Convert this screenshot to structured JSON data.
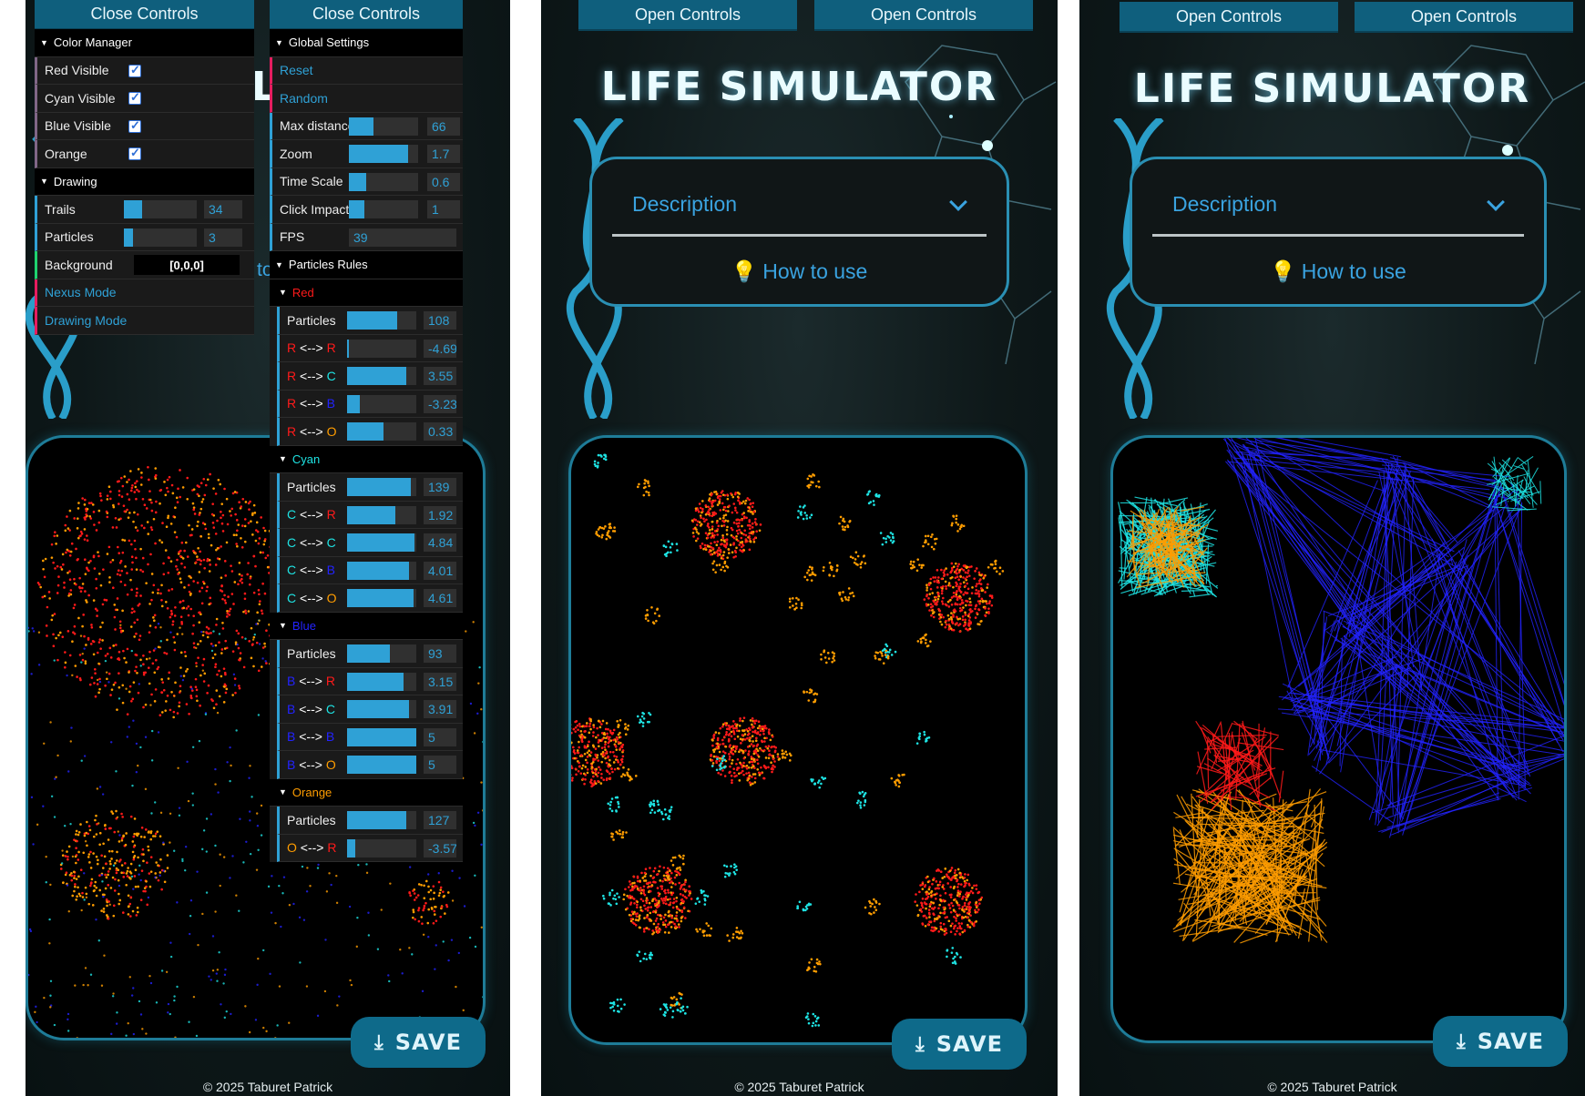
{
  "panels": {
    "p1": {
      "controls_left": "Close Controls",
      "controls_right": "Close Controls",
      "partial_title": "L",
      "partial_howto": "to",
      "save_label": "SAVE",
      "footer": "© 2025 Taburet Patrick",
      "color_manager": {
        "title": "Color Manager",
        "items": [
          {
            "label": "Red Visible",
            "checked": true
          },
          {
            "label": "Cyan Visible",
            "checked": true
          },
          {
            "label": "Blue Visible",
            "checked": true
          },
          {
            "label": "Orange",
            "checked": true
          }
        ]
      },
      "drawing": {
        "title": "Drawing",
        "trails_label": "Trails",
        "trails_value": "34",
        "trails_fill": 0.25,
        "particles_label": "Particles",
        "particles_value": "3",
        "particles_fill": 0.12,
        "background_label": "Background",
        "background_value": "[0,0,0]",
        "nexus_label": "Nexus Mode",
        "drawing_mode_label": "Drawing Mode"
      },
      "global": {
        "title": "Global Settings",
        "reset": "Reset",
        "random": "Random",
        "sliders": [
          {
            "label": "Max distance",
            "value": "66",
            "fill": 0.35
          },
          {
            "label": "Zoom",
            "value": "1.7",
            "fill": 0.85
          },
          {
            "label": "Time Scale",
            "value": "0.6",
            "fill": 0.25
          },
          {
            "label": "Click Impact",
            "value": "1",
            "fill": 0.22
          }
        ],
        "fps_label": "FPS",
        "fps_value": "39"
      },
      "rules": {
        "title": "Particles Rules",
        "groups": [
          {
            "name": "Red",
            "color": "#ff1a1a",
            "rows": [
              {
                "label": "Particles",
                "value": "108",
                "fill": 0.72
              },
              {
                "a": "R",
                "b": "R",
                "ac": "#ff1a1a",
                "bc": "#ff1a1a",
                "value": "-4.69",
                "fill": 0.03
              },
              {
                "a": "R",
                "b": "C",
                "ac": "#ff1a1a",
                "bc": "#1ee3e3",
                "value": "3.55",
                "fill": 0.86
              },
              {
                "a": "R",
                "b": "B",
                "ac": "#ff1a1a",
                "bc": "#2323ff",
                "value": "-3.23",
                "fill": 0.18
              },
              {
                "a": "R",
                "b": "O",
                "ac": "#ff1a1a",
                "bc": "#ff9d00",
                "value": "0.33",
                "fill": 0.53
              }
            ]
          },
          {
            "name": "Cyan",
            "color": "#1ee3e3",
            "rows": [
              {
                "label": "Particles",
                "value": "139",
                "fill": 0.92
              },
              {
                "a": "C",
                "b": "R",
                "ac": "#1ee3e3",
                "bc": "#ff1a1a",
                "value": "1.92",
                "fill": 0.7
              },
              {
                "a": "C",
                "b": "C",
                "ac": "#1ee3e3",
                "bc": "#1ee3e3",
                "value": "4.84",
                "fill": 0.98
              },
              {
                "a": "C",
                "b": "B",
                "ac": "#1ee3e3",
                "bc": "#2323ff",
                "value": "4.01",
                "fill": 0.9
              },
              {
                "a": "C",
                "b": "O",
                "ac": "#1ee3e3",
                "bc": "#ff9d00",
                "value": "4.61",
                "fill": 0.96
              }
            ]
          },
          {
            "name": "Blue",
            "color": "#2323ff",
            "rows": [
              {
                "label": "Particles",
                "value": "93",
                "fill": 0.62
              },
              {
                "a": "B",
                "b": "R",
                "ac": "#2323ff",
                "bc": "#ff1a1a",
                "value": "3.15",
                "fill": 0.82
              },
              {
                "a": "B",
                "b": "C",
                "ac": "#2323ff",
                "bc": "#1ee3e3",
                "value": "3.91",
                "fill": 0.89
              },
              {
                "a": "B",
                "b": "B",
                "ac": "#2323ff",
                "bc": "#2323ff",
                "value": "5",
                "fill": 1.0
              },
              {
                "a": "B",
                "b": "O",
                "ac": "#2323ff",
                "bc": "#ff9d00",
                "value": "5",
                "fill": 1.0
              }
            ]
          },
          {
            "name": "Orange",
            "color": "#ff9d00",
            "rows": [
              {
                "label": "Particles",
                "value": "127",
                "fill": 0.85
              },
              {
                "a": "O",
                "b": "R",
                "ac": "#ff9d00",
                "bc": "#ff1a1a",
                "value": "-3.57",
                "fill": 0.12
              }
            ]
          }
        ]
      }
    },
    "p2": {
      "controls_left": "Open Controls",
      "controls_right": "Open Controls",
      "title": "LIFE SIMULATOR",
      "description": "Description",
      "howto": "How to use",
      "save_label": "SAVE",
      "footer": "© 2025 Taburet Patrick"
    },
    "p3": {
      "controls_left": "Open Controls",
      "controls_right": "Open Controls",
      "title": "LIFE SIMULATOR",
      "description": "Description",
      "howto": "How to use",
      "save_label": "SAVE",
      "footer": "© 2025 Taburet Patrick"
    }
  },
  "colors": {
    "accent": "#2fa1d6",
    "panel_button": "#0f5f7d",
    "stage_border": "#1e7c98",
    "red": "#ff1a1a",
    "cyan": "#1ee3e3",
    "blue": "#2323ff",
    "orange": "#ff9d00"
  }
}
